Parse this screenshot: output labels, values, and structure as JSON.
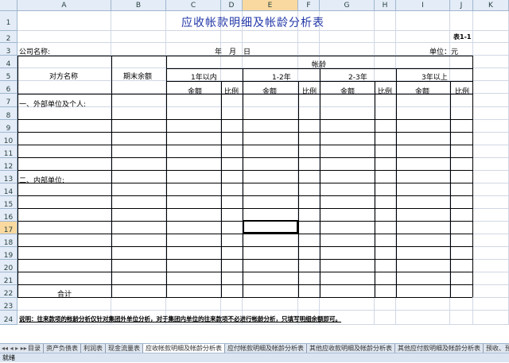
{
  "columns": [
    "A",
    "B",
    "C",
    "D",
    "E",
    "F",
    "G",
    "H",
    "I",
    "J",
    "K"
  ],
  "rows": [
    "1",
    "2",
    "3",
    "4",
    "5",
    "6",
    "7",
    "8",
    "9",
    "10",
    "11",
    "12",
    "13",
    "14",
    "15",
    "16",
    "17",
    "18",
    "19",
    "20",
    "21",
    "22",
    "23",
    "24"
  ],
  "sheet": {
    "title": "应收帐款明细及帐龄分析表",
    "table_no": "表1-1",
    "company_label": "公司名称:",
    "date_label": "年　月　日",
    "unit_label": "单位：元",
    "h_counterparty": "对方名称",
    "h_balance": "期末余额",
    "h_aging": "帐龄",
    "h_within1": "1年以内",
    "h_1to2": "1-2年",
    "h_2to3": "2-3年",
    "h_over3": "3年以上",
    "h_amount": "金额",
    "h_ratio": "比例",
    "section_external": "一、外部单位及个人:",
    "section_internal": "二、内部单位:",
    "total": "合计",
    "note": "说明：往来款项的帐龄分析仅针对集团外单位分析，对于集团内单位的往来款项不必进行帐龄分析，只填写明细余额即可。"
  },
  "tabs": [
    "目录",
    "资产负债表",
    "利润表",
    "现金流量表",
    "应收帐款明细及帐龄分析表",
    "应付帐款明细及帐龄分析表",
    "其他应收款明细及帐龄分析表",
    "其他应付款明细及帐龄分析表",
    "预收、预付帐款"
  ],
  "active_tab_index": 4,
  "status": "就绪",
  "selected_col": "E",
  "selected_row": "17"
}
